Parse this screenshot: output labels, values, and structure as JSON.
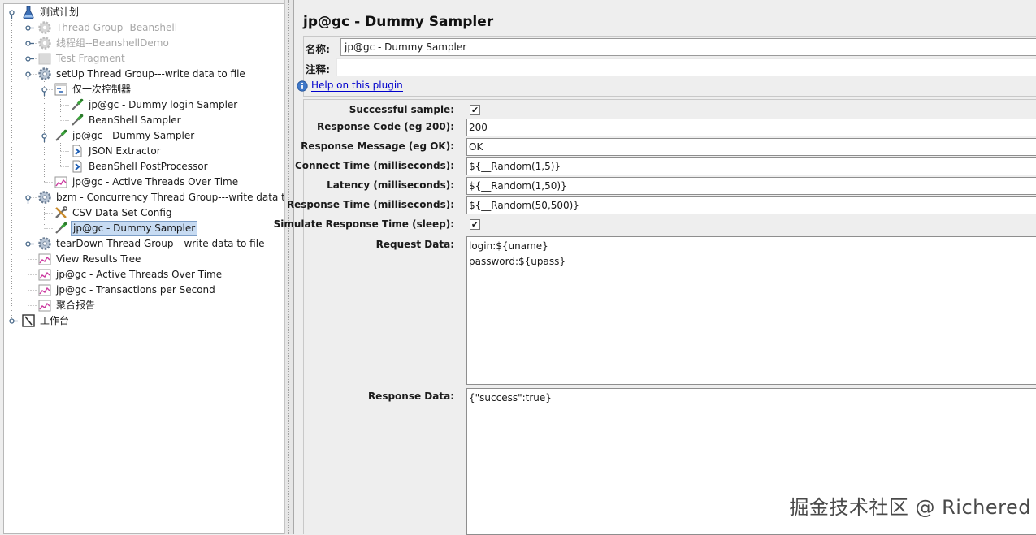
{
  "tree": {
    "items": [
      {
        "label": "测试计划",
        "icon": "test-plan-icon"
      },
      {
        "label": "Thread Group--Beanshell",
        "icon": "thread-group-gear-icon"
      },
      {
        "label": "线程组--BeanshellDemo",
        "icon": "thread-group-gear-icon"
      },
      {
        "label": "Test Fragment",
        "icon": "test-fragment-icon"
      },
      {
        "label": "setUp Thread Group---write data to file",
        "icon": "thread-group-gear-icon"
      },
      {
        "label": "仅一次控制器",
        "icon": "controller-icon"
      },
      {
        "label": "jp@gc - Dummy login Sampler",
        "icon": "sampler-pipette-icon"
      },
      {
        "label": "BeanShell Sampler",
        "icon": "sampler-pipette-icon"
      },
      {
        "label": "jp@gc - Dummy Sampler",
        "icon": "sampler-pipette-icon"
      },
      {
        "label": "JSON Extractor",
        "icon": "post-processor-icon"
      },
      {
        "label": "BeanShell PostProcessor",
        "icon": "post-processor-icon"
      },
      {
        "label": "jp@gc - Active Threads Over Time",
        "icon": "listener-graph-icon"
      },
      {
        "label": "bzm - Concurrency Thread Group---write data to file",
        "icon": "thread-group-gear-icon"
      },
      {
        "label": "CSV Data Set Config",
        "icon": "config-tools-icon"
      },
      {
        "label": "jp@gc - Dummy Sampler",
        "icon": "sampler-pipette-icon"
      },
      {
        "label": "tearDown Thread Group---write data to file",
        "icon": "thread-group-gear-icon"
      },
      {
        "label": "View Results Tree",
        "icon": "listener-graph-icon"
      },
      {
        "label": "jp@gc - Active Threads Over Time",
        "icon": "listener-graph-icon"
      },
      {
        "label": "jp@gc - Transactions per Second",
        "icon": "listener-graph-icon"
      },
      {
        "label": "聚合报告",
        "icon": "listener-graph-icon"
      },
      {
        "label": "工作台",
        "icon": "workbench-icon"
      }
    ]
  },
  "panel": {
    "title": "jp@gc - Dummy Sampler",
    "name_label": "名称:",
    "name_value": "jp@gc - Dummy Sampler",
    "comment_label": "注释:",
    "comment_value": "",
    "help_link": "Help on this plugin"
  },
  "form": {
    "successful_sample_label": "Successful sample:",
    "successful_sample_checked": true,
    "response_code_label": "Response Code (eg 200):",
    "response_code": "200",
    "response_message_label": "Response Message (eg OK):",
    "response_message": "OK",
    "connect_time_label": "Connect Time (milliseconds):",
    "connect_time": "${__Random(1,5)}",
    "latency_label": "Latency (milliseconds):",
    "latency": "${__Random(1,50)}",
    "response_time_label": "Response Time (milliseconds):",
    "response_time": "${__Random(50,500)}",
    "simulate_label": "Simulate Response Time (sleep):",
    "simulate_checked": true,
    "request_data_label": "Request Data:",
    "request_data": "login:${uname}\npassword:${upass}",
    "response_data_label": "Response Data:",
    "response_data": "{\"success\":true}",
    "check_mark": "✔"
  },
  "watermark": "掘金技术社区 @ Richered"
}
